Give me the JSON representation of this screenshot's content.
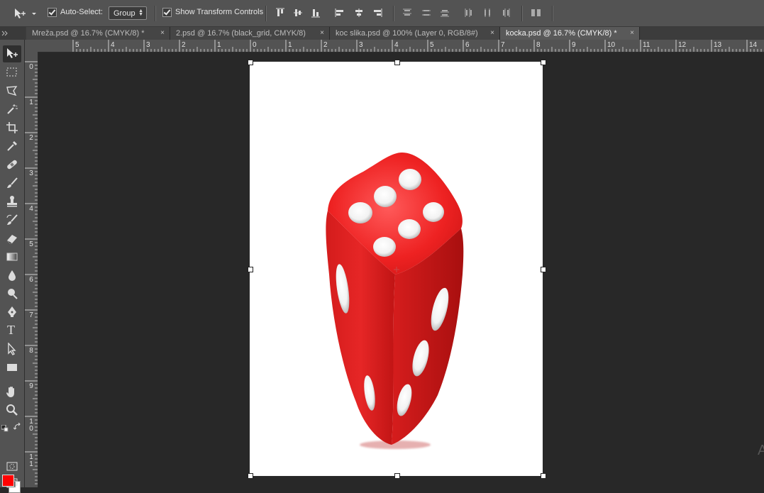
{
  "options_bar": {
    "auto_select_label": "Auto-Select:",
    "auto_select_value": "Group",
    "show_transform_label": "Show Transform Controls"
  },
  "tabs": [
    {
      "label": "Mreža.psd @ 16.7% (CMYK/8) *",
      "active": false
    },
    {
      "label": "2.psd @ 16.7% (black_grid, CMYK/8)",
      "active": false
    },
    {
      "label": "koc slika.psd @ 100% (Layer 0, RGB/8#)",
      "active": false
    },
    {
      "label": "kocka.psd @ 16.7% (CMYK/8) *",
      "active": true
    }
  ],
  "tab_close": "×",
  "tools": [
    "move-tool",
    "marquee-tool",
    "lasso-tool",
    "magic-wand-tool",
    "crop-tool",
    "eyedropper-tool",
    "healing-brush-tool",
    "brush-tool",
    "clone-stamp-tool",
    "history-brush-tool",
    "eraser-tool",
    "gradient-tool",
    "blur-tool",
    "dodge-tool",
    "pen-tool",
    "type-tool",
    "path-selection-tool",
    "rectangle-tool",
    "hand-tool",
    "zoom-tool"
  ],
  "colors": {
    "foreground": "#ff0000",
    "background": "#ffffff"
  },
  "ruler_top_labels": [
    "5",
    "4",
    "3",
    "2",
    "1",
    "0",
    "1",
    "2",
    "3",
    "4",
    "5",
    "6",
    "7",
    "8",
    "9",
    "10",
    "11",
    "12",
    "13",
    "14"
  ],
  "ruler_left_labels": [
    "0",
    "1",
    "2",
    "3",
    "4",
    "5",
    "6",
    "7",
    "8",
    "9",
    "1\n0",
    "1\n1"
  ],
  "type_tool_glyph": "T",
  "watermark_text": "A"
}
